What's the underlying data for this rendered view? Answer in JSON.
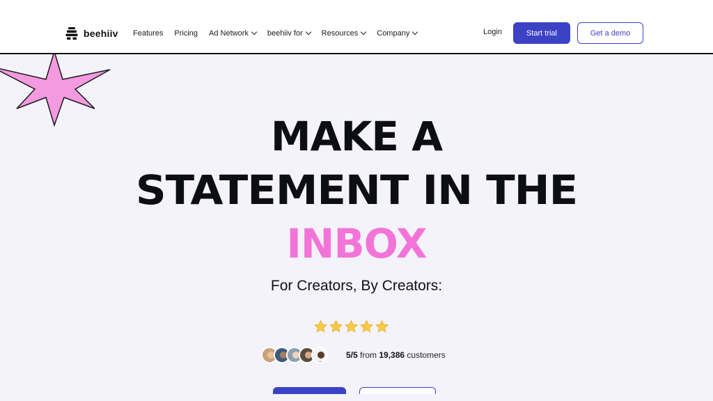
{
  "brand": {
    "name": "beehiiv",
    "logo_icon": "beehive-icon"
  },
  "nav": {
    "items": [
      {
        "label": "Features",
        "dropdown": false
      },
      {
        "label": "Pricing",
        "dropdown": false
      },
      {
        "label": "Ad Network",
        "dropdown": true
      },
      {
        "label": "beehiiv for",
        "dropdown": true
      },
      {
        "label": "Resources",
        "dropdown": true
      },
      {
        "label": "Company",
        "dropdown": true
      }
    ],
    "login_label": "Login",
    "trial_label": "Start trial",
    "demo_label": "Get a demo"
  },
  "hero": {
    "headline_line1": "MAKE A",
    "headline_line2": "STATEMENT IN THE",
    "headline_accent": "INBOX",
    "subtitle": "For Creators, By Creators:",
    "rating": {
      "stars": 5,
      "score": "5/5",
      "from_text": "from",
      "count": "19,386",
      "customers_text": "customers"
    }
  },
  "colors": {
    "primary": "#3b42c4",
    "accent_pink": "#f374d8",
    "hero_bg": "#f4f3fb",
    "star_gold": "#f7c948",
    "text_dark": "#0d0d14"
  }
}
